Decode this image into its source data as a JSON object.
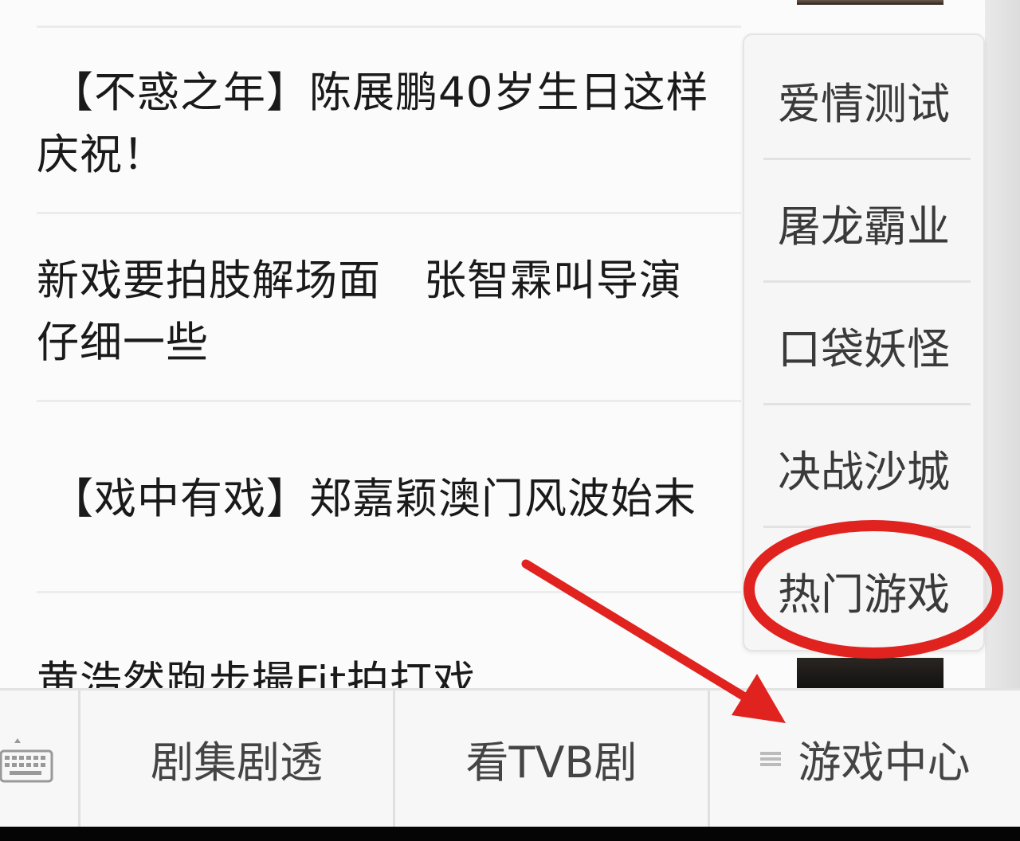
{
  "news_list": {
    "headlines": [
      {
        "line1": "【不惑之年】陈展鹏40岁生日这样",
        "line2": "庆祝！"
      },
      {
        "line1": "新戏要拍肢解场面　张智霖叫导演",
        "line2": "仔细一些"
      },
      {
        "line1": "【戏中有戏】郑嘉颖澳门风波始末"
      },
      {
        "line1": "黄浩然跑步撮Fit拍打戏"
      }
    ]
  },
  "popup_menu": {
    "items": [
      {
        "label": "爱情测试"
      },
      {
        "label": "屠龙霸业"
      },
      {
        "label": "口袋妖怪"
      },
      {
        "label": "决战沙城"
      },
      {
        "label": "热门游戏"
      }
    ]
  },
  "bottom_bar": {
    "keyboard_icon": "keyboard-icon",
    "tabs": [
      {
        "label": "剧集剧透"
      },
      {
        "label": "看TVB剧"
      },
      {
        "label": "游戏中心",
        "icon": "menu-lines-icon"
      }
    ]
  },
  "annotation": {
    "circle_color": "#e0231f",
    "arrow_color": "#e0231f"
  }
}
